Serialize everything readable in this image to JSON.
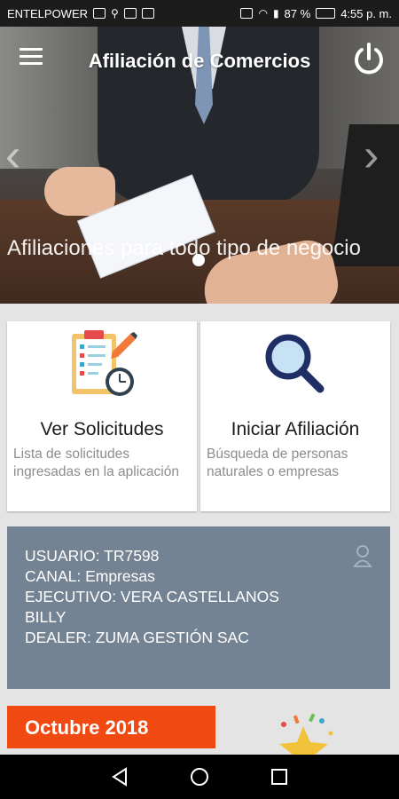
{
  "status_bar": {
    "carrier": "ENTELPOWER",
    "signal_percent": "87 %",
    "time": "4:55 p. m."
  },
  "header": {
    "title": "Afiliación de Comercios"
  },
  "hero": {
    "caption": "Afiliaciones para todo tipo de negocio",
    "slide_count": 1,
    "active_slide": 1
  },
  "cards": [
    {
      "title": "Ver Solicitudes",
      "description": "Lista de solicitudes ingresadas en la aplicación"
    },
    {
      "title": "Iniciar Afiliación",
      "description": "Búsqueda de personas naturales o empresas"
    }
  ],
  "user_info": {
    "usuario": "USUARIO: TR7598",
    "canal": "CANAL: Empresas",
    "ejecutivo": "EJECUTIVO: VERA CASTELLANOS BILLY",
    "dealer": "DEALER: ZUMA GESTIÓN SAC"
  },
  "month_badge": "Octubre 2018",
  "colors": {
    "accent": "#f04a12",
    "panel": "#748393",
    "background": "#e4e4e4"
  },
  "icons": {
    "menu": "hamburger-icon",
    "power": "power-icon",
    "clipboard": "clipboard-checklist-icon",
    "search": "magnifier-icon",
    "user": "user-icon",
    "back": "back-triangle-icon",
    "home": "home-circle-icon",
    "recents": "recents-square-icon"
  }
}
